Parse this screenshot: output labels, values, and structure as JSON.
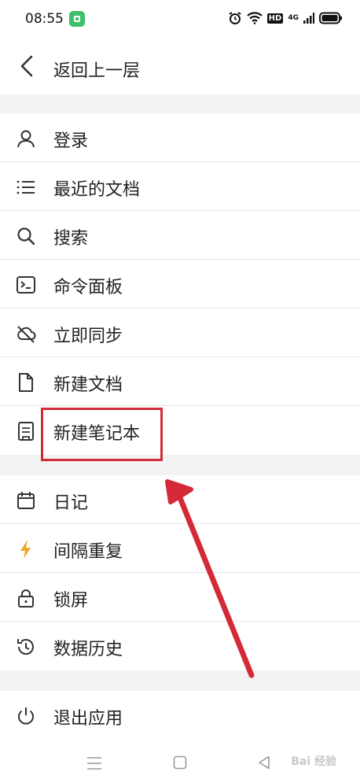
{
  "status_bar": {
    "time": "08:55",
    "hd": "HD",
    "network": "4G"
  },
  "header": {
    "back_label": "返回上一层"
  },
  "menu": {
    "group1": [
      {
        "label": "登录",
        "icon": "user-icon"
      },
      {
        "label": "最近的文档",
        "icon": "list-icon"
      },
      {
        "label": "搜索",
        "icon": "search-icon"
      },
      {
        "label": "命令面板",
        "icon": "terminal-icon"
      },
      {
        "label": "立即同步",
        "icon": "cloud-off-icon"
      },
      {
        "label": "新建文档",
        "icon": "file-icon"
      },
      {
        "label": "新建笔记本",
        "icon": "notebook-icon"
      }
    ],
    "group2": [
      {
        "label": "日记",
        "icon": "calendar-icon"
      },
      {
        "label": "间隔重复",
        "icon": "lightning-icon"
      },
      {
        "label": "锁屏",
        "icon": "lock-icon"
      },
      {
        "label": "数据历史",
        "icon": "history-icon"
      }
    ],
    "group3": [
      {
        "label": "退出应用",
        "icon": "power-icon"
      }
    ]
  },
  "colors": {
    "highlight": "#d42a37",
    "lightning": "#f0a52a",
    "separator": "#f2f2f2"
  },
  "watermark": "Bai 经验"
}
